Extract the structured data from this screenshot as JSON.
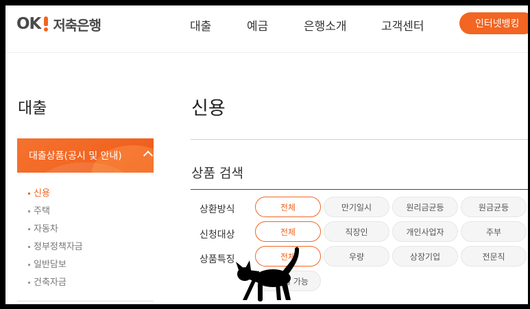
{
  "header": {
    "logo": {
      "ok": "OK",
      "name": "저축은행"
    },
    "nav": [
      "대출",
      "예금",
      "은행소개",
      "고객센터"
    ],
    "internet_banking": "인터넷뱅킹"
  },
  "sidebar": {
    "title": "대출",
    "active_group": "대출상품(공시 및 안내)",
    "items": [
      {
        "label": "신용",
        "active": true
      },
      {
        "label": "주택",
        "active": false
      },
      {
        "label": "자동차",
        "active": false
      },
      {
        "label": "정부정책자금",
        "active": false
      },
      {
        "label": "일반담보",
        "active": false
      },
      {
        "label": "건축자금",
        "active": false
      }
    ]
  },
  "main": {
    "title": "신용",
    "search_title": "상품 검색",
    "filters": [
      {
        "label": "상환방식",
        "options": [
          "전체",
          "만기일시",
          "원리금균등",
          "원금균등"
        ],
        "selected": 0
      },
      {
        "label": "신청대상",
        "options": [
          "전체",
          "직장인",
          "개인사업자",
          "주부"
        ],
        "selected": 0
      },
      {
        "label": "상품특징",
        "options": [
          "전체",
          "우량",
          "상장기업",
          "전문직",
          "365일 가능"
        ],
        "selected": 0
      }
    ]
  },
  "colors": {
    "accent": "#f26522",
    "text": "#333333",
    "chip_bg": "#f5f5f5"
  }
}
